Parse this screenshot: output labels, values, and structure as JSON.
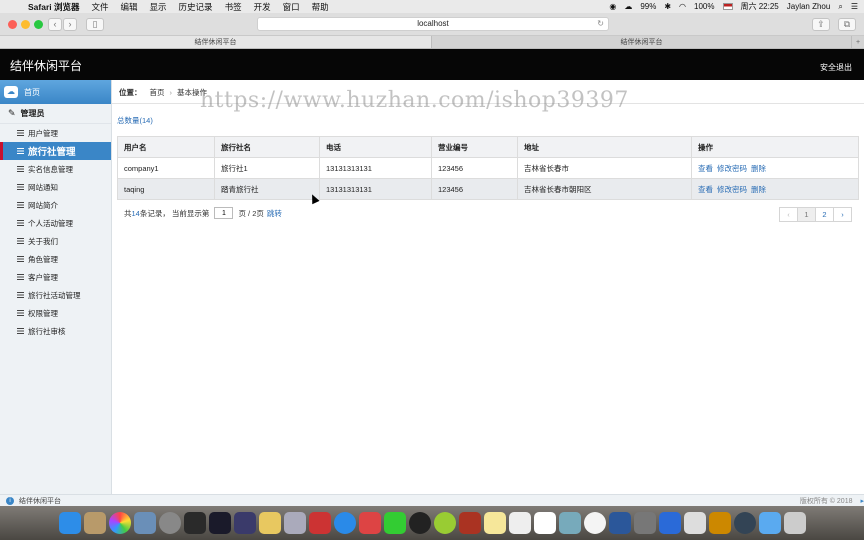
{
  "menubar": {
    "app": "Safari 浏览器",
    "items": [
      "文件",
      "编辑",
      "显示",
      "历史记录",
      "书签",
      "开发",
      "窗口",
      "帮助"
    ],
    "battery": "99%",
    "battery2": "100%",
    "clock": "周六 22:25",
    "user": "Jaylan Zhou"
  },
  "browser": {
    "url": "localhost",
    "tabs": [
      "结伴休闲平台",
      "结伴休闲平台"
    ]
  },
  "header": {
    "title": "结伴休闲平台",
    "logout": "安全退出"
  },
  "sidebar": {
    "home": "首页",
    "section": "管理员",
    "items": [
      {
        "label": "用户管理"
      },
      {
        "label": "旅行社管理",
        "active": true
      },
      {
        "label": "实名信息管理"
      },
      {
        "label": "网站通知"
      },
      {
        "label": "网站简介"
      },
      {
        "label": "个人活动管理"
      },
      {
        "label": "关于我们"
      },
      {
        "label": "角色管理"
      },
      {
        "label": "客户管理"
      },
      {
        "label": "旅行社活动管理"
      },
      {
        "label": "权限管理"
      },
      {
        "label": "旅行社审核"
      }
    ]
  },
  "breadcrumb": {
    "label": "位置：",
    "home": "首页",
    "current": "基本操作"
  },
  "watermark": "https://www.huzhan.com/ishop39397",
  "count_label": "总数量(14)",
  "table": {
    "headers": [
      "用户名",
      "旅行社名",
      "电话",
      "营业编号",
      "地址",
      "操作"
    ],
    "rows": [
      {
        "username": "company1",
        "agency": "旅行社1",
        "phone": "13131313131",
        "license": "123456",
        "address": "吉林省长春市"
      },
      {
        "username": "taqing",
        "agency": "踏青旅行社",
        "phone": "13131313131",
        "license": "123456",
        "address": "吉林省长春市朝阳区"
      }
    ],
    "actions": [
      "查看",
      "修改密码",
      "删除"
    ]
  },
  "pagination": {
    "prefix": "共",
    "total": "14",
    "suffix": "条记录，  当前显示第",
    "current": "1",
    "of": "页 / 2页",
    "jump": "跳转",
    "prev": "‹",
    "pages": [
      "1",
      "2"
    ],
    "next": "›"
  },
  "footer": {
    "text": "结伴休闲平台",
    "copyright": "版权所有 © 2018"
  },
  "colors": {
    "accent": "#3a86c7",
    "header_bg": "#060606",
    "active_marker": "#c8102e"
  }
}
